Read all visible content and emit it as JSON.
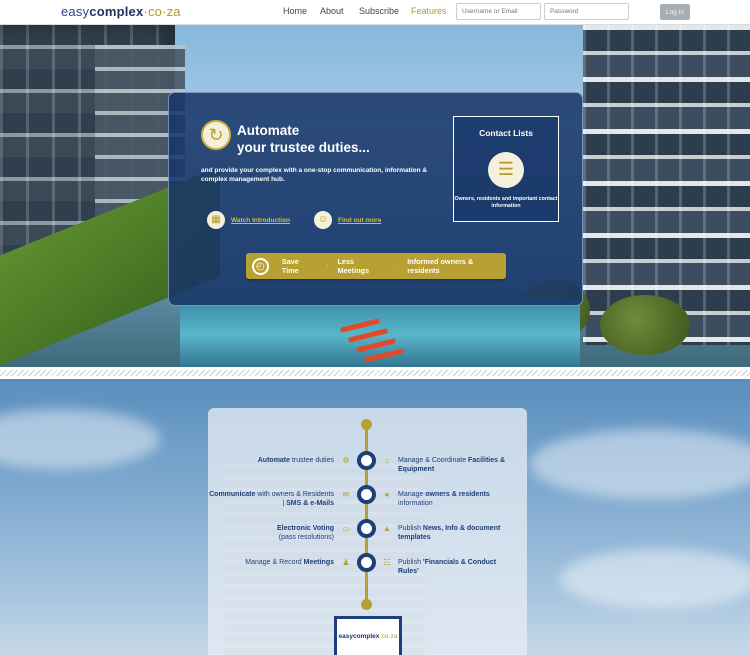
{
  "brand": {
    "part1": "easy",
    "part2": "complex",
    "part3": "·co·za"
  },
  "nav": [
    {
      "label": "Home"
    },
    {
      "label": "About"
    },
    {
      "label": "Subscribe"
    },
    {
      "label": "Features"
    }
  ],
  "login": {
    "username_placeholder": "Username or Email",
    "password_placeholder": "Password",
    "button": "Log In"
  },
  "hero": {
    "title_line1": "Automate",
    "title_line2": "your trustee duties...",
    "subtitle": "and provide your complex with a one-stop communication, information & complex management hub.",
    "watch_link": "Watch Introduction",
    "find_link": "Find out more",
    "contact": {
      "title": "Contact Lists",
      "desc": "Owners, residents and important contact information"
    },
    "benefits": [
      "Save Time",
      "Less Meetings",
      "Informed owners & residents"
    ],
    "separator": "·"
  },
  "features": {
    "left": [
      {
        "bold": "Automate",
        "text": " trustee duties"
      },
      {
        "bold": "Communicate",
        "text": " with owners & Residents | ",
        "bold2": "SMS & e-Mails"
      },
      {
        "bold": "Electronic Voting",
        "text": "(pass resolutions)"
      },
      {
        "text": "Manage & Record ",
        "bold": "Meetings"
      }
    ],
    "right": [
      {
        "text": "Manage & Coordinate ",
        "bold": "Facilities & Equipment"
      },
      {
        "text": "Manage ",
        "bold": "owners & residents",
        "text2": " information"
      },
      {
        "text": "Publish ",
        "bold": "News, Info & document templates"
      },
      {
        "text": "Publish ",
        "bold": "'Financials & Conduct Rules'"
      }
    ]
  },
  "badge": {
    "main": "easycomplex",
    "suffix": "·co·za"
  },
  "icons": {
    "auto": "refresh-icon",
    "contact": "list-icon",
    "watch": "calendar-icon",
    "find": "person-icon",
    "clock": "clock-icon"
  },
  "colors": {
    "navy": "#1e3e78",
    "gold": "#b8a030",
    "panel": "#163468"
  }
}
